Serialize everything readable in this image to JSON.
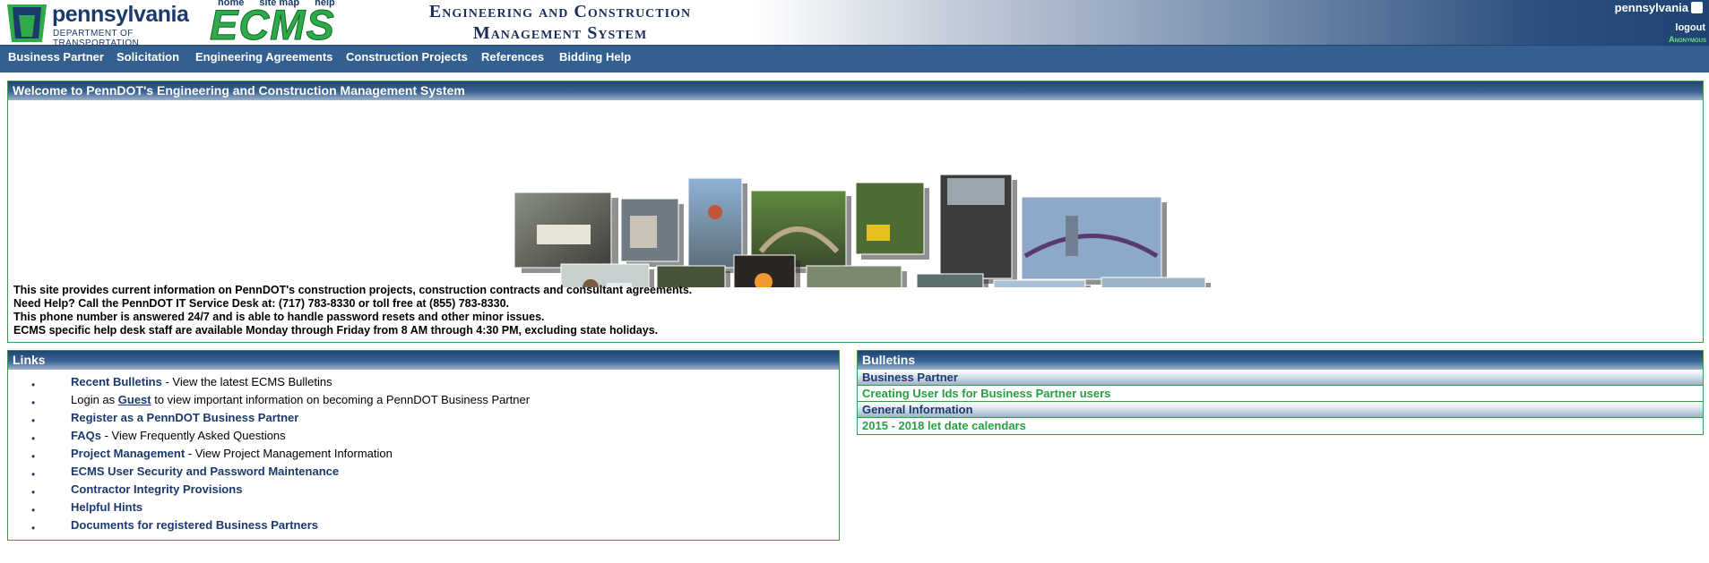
{
  "header": {
    "logo_name": "pennsylvania",
    "logo_subtitle": "DEPARTMENT OF TRANSPORTATION",
    "app_logo": "ECMS",
    "top_links": [
      "home",
      "site map",
      "help"
    ],
    "system_title_line1": "Engineering and Construction",
    "system_title_line2": "Management System",
    "state_label": "pennsylvania",
    "logout": "logout",
    "user": "Anonymous"
  },
  "nav": [
    "Business Partner",
    "Solicitation",
    "Engineering Agreements",
    "Construction Projects",
    "References",
    "Bidding Help"
  ],
  "welcome": {
    "title": "Welcome to PennDOT's Engineering and Construction Management System",
    "lines": [
      "This site provides current information on PennDOT's construction projects, construction contracts and consultant agreements.",
      "Need Help? Call the PennDOT IT Service Desk at: (717) 783-8330 or toll free at (855) 783-8330.",
      "This phone number is answered 24/7 and is able to handle password resets and other minor issues.",
      "ECMS specific help desk staff are available Monday through Friday from 8 AM through 4:30 PM, excluding state holidays."
    ]
  },
  "links": {
    "title": "Links",
    "items": [
      {
        "link": "Recent Bulletins",
        "text": " - View the latest ECMS Bulletins"
      },
      {
        "pre": "Login as ",
        "link": "Guest",
        "text": " to view important information on becoming a PennDOT Business Partner"
      },
      {
        "link": "Register as a PennDOT Business Partner",
        "text": ""
      },
      {
        "link": "FAQs",
        "text": " - View Frequently Asked Questions"
      },
      {
        "link": "Project Management",
        "text": " - View Project Management Information"
      },
      {
        "link": "ECMS User Security and Password Maintenance",
        "text": ""
      },
      {
        "link": "Contractor Integrity Provisions",
        "text": ""
      },
      {
        "link": "Helpful Hints",
        "text": ""
      },
      {
        "link": "Documents for registered Business Partners",
        "text": ""
      }
    ]
  },
  "bulletins": {
    "title": "Bulletins",
    "sections": [
      {
        "category": "Business Partner",
        "items": [
          "Creating User Ids for Business Partner users"
        ]
      },
      {
        "category": "General Information",
        "items": [
          "2015 - 2018 let date calendars"
        ]
      }
    ]
  },
  "colors": {
    "nav_bg": "#34608f",
    "dark_blue": "#1b3a6b",
    "green": "#26a040"
  }
}
